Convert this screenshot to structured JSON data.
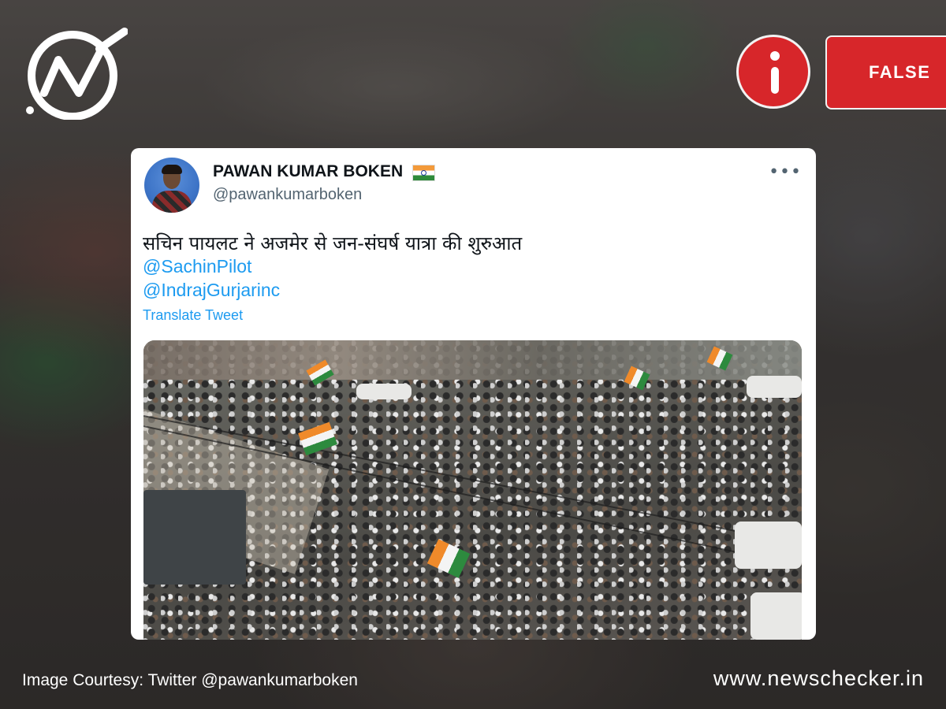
{
  "brand": {
    "logo_icon": "newschecker-logo-icon"
  },
  "verdict": {
    "icon": "info-icon",
    "label": "FALSE",
    "color": "#d7262a"
  },
  "tweet": {
    "author_name": "PAWAN KUMAR BOKEN",
    "author_flag_icon": "india-flag-icon",
    "handle": "@pawankumarboken",
    "more_icon": "more-options-icon",
    "text": "सचिन पायलट ने अजमेर से जन-संघर्ष यात्रा की शुरुआत",
    "mentions": [
      "@SachinPilot",
      "@IndrajGurjarinc"
    ],
    "translate_label": "Translate Tweet",
    "link_color": "#1d9bf0"
  },
  "footer": {
    "courtesy": "Image Courtesy: Twitter @pawankumarboken",
    "site": "www.newschecker.in"
  }
}
